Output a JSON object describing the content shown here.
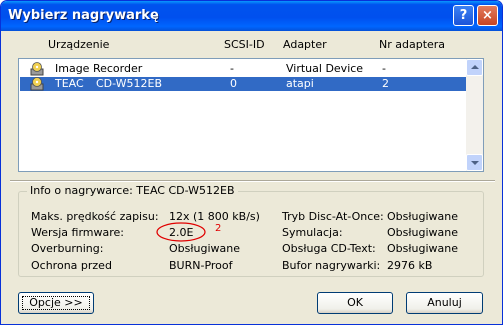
{
  "window": {
    "title": "Wybierz nagrywarkę",
    "help_label": "?",
    "close_label": "×"
  },
  "columns": [
    "Urządzenie",
    "SCSI-ID",
    "Adapter",
    "Nr adaptera"
  ],
  "devices": [
    {
      "name": "Image Recorder",
      "model": "",
      "scsi_id": "-",
      "adapter": "Virtual Device",
      "adapter_no": "-"
    },
    {
      "name": "TEAC",
      "model": "CD-W512EB",
      "scsi_id": "0",
      "adapter": "atapi",
      "adapter_no": "2"
    }
  ],
  "info": {
    "legend": "Info o nagrywarce: TEAC     CD-W512EB",
    "left": [
      {
        "label": "Maks. prędkość zapisu:",
        "value": "12x (1 800 kB/s)"
      },
      {
        "label": "Wersja firmware:",
        "value": "2.0E"
      },
      {
        "label": "Overburning:",
        "value": "Obsługiwane"
      },
      {
        "label": "Ochrona przed",
        "value": "BURN-Proof"
      }
    ],
    "right": [
      {
        "label": "Tryb Disc-At-Once:",
        "value": "Obsługiwane"
      },
      {
        "label": "Symulacja:",
        "value": "Obsługiwane"
      },
      {
        "label": "Obsługa CD-Text:",
        "value": "Obsługiwane"
      },
      {
        "label": "Bufor nagrywarki:",
        "value": "2976 kB"
      }
    ],
    "annotation_mark": "2"
  },
  "buttons": {
    "options": "Opcje >>",
    "ok": "OK",
    "cancel": "Anuluj"
  },
  "colors": {
    "titlebar": "#0053ee",
    "selection": "#316ac5",
    "annotation": "#e00000"
  }
}
